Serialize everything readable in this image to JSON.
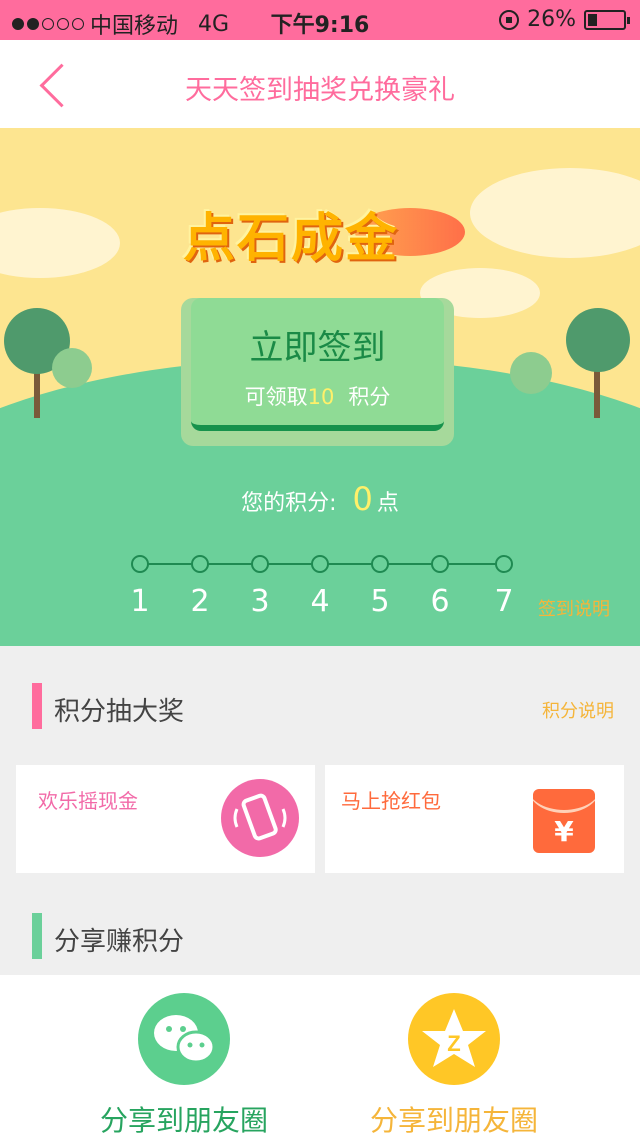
{
  "status_bar": {
    "carrier": "中国移动",
    "network": "4G",
    "time": "下午9:16",
    "battery": "26%",
    "battery_level": 0.26
  },
  "nav": {
    "title": "天天签到抽奖兑换豪礼"
  },
  "hero": {
    "logo_text": "点石成金",
    "signin_title": "立即签到",
    "signin_prefix": "可领取",
    "signin_points": "10",
    "signin_suffix": "积分",
    "points_label": "您的积分:",
    "points_value": "0",
    "points_unit": "点",
    "steps": [
      "1",
      "2",
      "3",
      "4",
      "5",
      "6",
      "7"
    ],
    "sign_desc": "签到说明"
  },
  "lottery": {
    "title": "积分抽大奖",
    "link": "积分说明",
    "cards": [
      {
        "label": "欢乐摇现金",
        "color": "#f26aa8",
        "icon": "phone-shake-icon"
      },
      {
        "label": "马上抢红包",
        "color": "#ff6a3c",
        "icon": "red-envelope-icon"
      }
    ]
  },
  "share_section": {
    "title": "分享赚积分"
  },
  "share": [
    {
      "label": "分享到朋友圈",
      "color": "#5ccf8e",
      "icon": "wechat-icon"
    },
    {
      "label": "分享到朋友圈",
      "color": "#ffc726",
      "icon": "qzone-icon"
    }
  ],
  "colors": {
    "accent": "#ff6c9d",
    "green": "#6bd09a",
    "yellow": "#f5b53a"
  }
}
